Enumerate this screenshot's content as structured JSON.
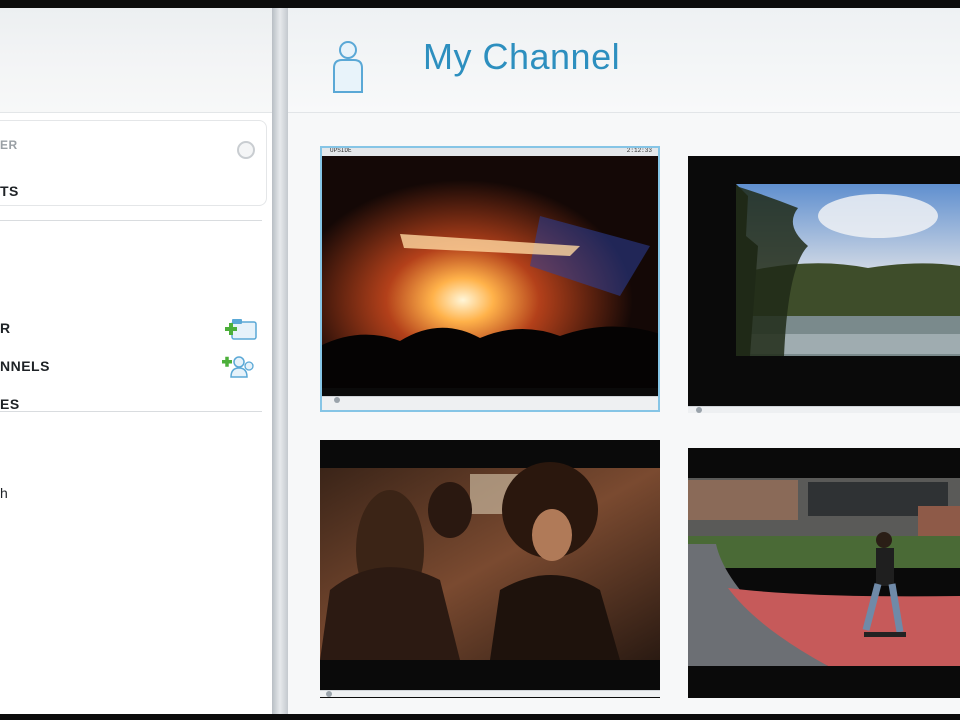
{
  "main": {
    "title": "My Channel",
    "tiles": [
      {
        "top_label": "UPSIDE",
        "time_label": "2:12:33",
        "scene": "concert"
      },
      {
        "scene": "lake"
      },
      {
        "scene": "party"
      },
      {
        "scene": "skatepark"
      }
    ]
  },
  "sidebar": {
    "items": [
      {
        "label": "ER",
        "style": "muted"
      },
      {
        "label": "TS"
      },
      {
        "label": "R"
      },
      {
        "label": "NNELS"
      },
      {
        "label": "ES"
      },
      {
        "label": "h"
      }
    ]
  },
  "icons": {
    "user": "user-icon",
    "add_folder": "add-folder-icon",
    "add_channel": "add-channel-icon",
    "circle": "circle-button-icon"
  },
  "colors": {
    "title": "#2d8fbf",
    "icon_blue": "#5aa8d6",
    "add_green": "#4caf3a"
  }
}
